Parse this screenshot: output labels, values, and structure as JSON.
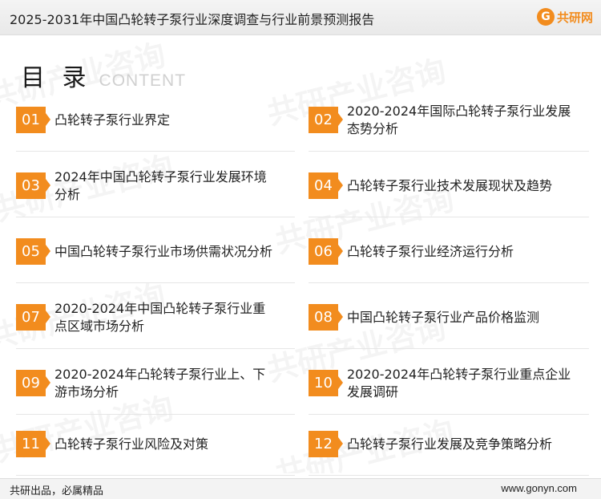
{
  "header": {
    "title": "2025-2031年中国凸轮转子泵行业深度调查与行业前景预测报告",
    "logo_text": "共研网",
    "logo_icon": "g-logo-icon",
    "brand_color": "#f28c1e"
  },
  "heading": {
    "cn": "目 录",
    "en": "CONTENT"
  },
  "watermark": {
    "text": "共研产业咨询",
    "sub": "www.gonyn.com"
  },
  "toc": [
    {
      "num": "01",
      "title": "凸轮转子泵行业界定"
    },
    {
      "num": "02",
      "title": "2020-2024年国际凸轮转子泵行业发展态势分析"
    },
    {
      "num": "03",
      "title": "2024年中国凸轮转子泵行业发展环境分析"
    },
    {
      "num": "04",
      "title": "凸轮转子泵行业技术发展现状及趋势"
    },
    {
      "num": "05",
      "title": "中国凸轮转子泵行业市场供需状况分析"
    },
    {
      "num": "06",
      "title": "凸轮转子泵行业经济运行分析"
    },
    {
      "num": "07",
      "title": "2020-2024年中国凸轮转子泵行业重点区域市场分析"
    },
    {
      "num": "08",
      "title": "中国凸轮转子泵行业产品价格监测"
    },
    {
      "num": "09",
      "title": "2020-2024年凸轮转子泵行业上、下游市场分析"
    },
    {
      "num": "10",
      "title": "2020-2024年凸轮转子泵行业重点企业发展调研"
    },
    {
      "num": "11",
      "title": "凸轮转子泵行业风险及对策"
    },
    {
      "num": "12",
      "title": "凸轮转子泵行业发展及竞争策略分析"
    }
  ],
  "footer": {
    "left": "共研出品，必属精品",
    "right": "www.gonyn.com"
  }
}
